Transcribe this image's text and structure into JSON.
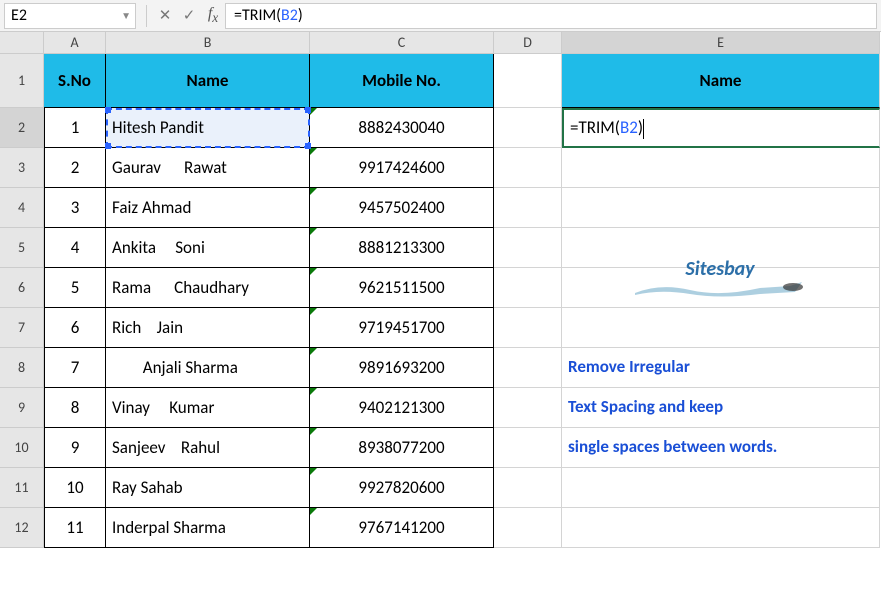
{
  "formula_bar": {
    "name_box": "E2",
    "formula_prefix": "=TRIM(",
    "formula_ref": "B2",
    "formula_suffix": ")"
  },
  "columns": [
    "A",
    "B",
    "C",
    "D",
    "E"
  ],
  "headers": {
    "sno": "S.No",
    "name": "Name",
    "mobile": "Mobile No.",
    "name2": "Name"
  },
  "rows": [
    {
      "sno": "1",
      "name": "Hitesh Pandit",
      "mobile": "8882430040"
    },
    {
      "sno": "2",
      "name": "Gaurav      Rawat",
      "mobile": "9917424600"
    },
    {
      "sno": "3",
      "name": "Faiz Ahmad",
      "mobile": "9457502400"
    },
    {
      "sno": "4",
      "name": "Ankita     Soni",
      "mobile": "8881213300"
    },
    {
      "sno": "5",
      "name": "Rama      Chaudhary",
      "mobile": "9621511500"
    },
    {
      "sno": "6",
      "name": "Rich    Jain",
      "mobile": "9719451700"
    },
    {
      "sno": "7",
      "name": "        Anjali Sharma",
      "mobile": "9891693200"
    },
    {
      "sno": "8",
      "name": "Vinay     Kumar",
      "mobile": "9402121300"
    },
    {
      "sno": "9",
      "name": "Sanjeev    Rahul",
      "mobile": "8938077200"
    },
    {
      "sno": "10",
      "name": "Ray Sahab",
      "mobile": "9927820600"
    },
    {
      "sno": "11",
      "name": "Inderpal Sharma",
      "mobile": "9767141200"
    }
  ],
  "edit_cell": {
    "prefix": "=TRIM(",
    "ref": "B2",
    "suffix": ")"
  },
  "note": {
    "line1": "Remove Irregular",
    "line2": "Text Spacing and keep",
    "line3": "single spaces between words."
  },
  "watermark": "Sitesbay"
}
